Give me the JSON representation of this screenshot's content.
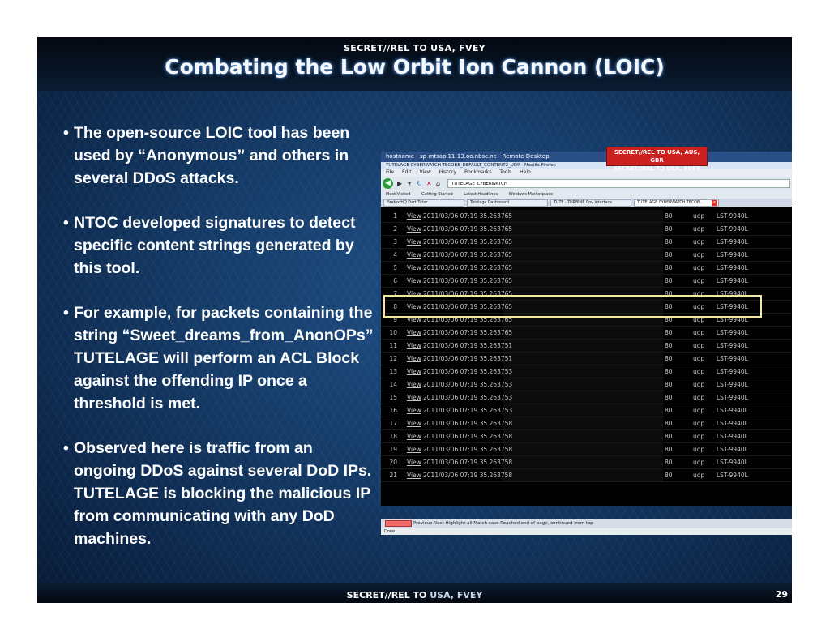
{
  "slide": {
    "classification_top": "SECRET//REL TO USA, FVEY",
    "title": "Combating the Low Orbit Ion Cannon (LOIC)",
    "classification_bottom_a": "SECRET//REL TO",
    "classification_bottom_b": "USA, FVEY",
    "page_number": "29",
    "bullets": [
      "The open-source LOIC tool has been used by “Anonymous” and others in several DDoS attacks.",
      "NTOC developed signatures to detect specific content strings generated by this tool.",
      "For example, for packets containing the string “Sweet_dreams_from_AnonOPs” TUTELAGE will perform an ACL Block against the offending IP once a threshold is met.",
      "Observed here is traffic from an ongoing DDoS against several DoD IPs. TUTELAGE is blocking the malicious IP from communicating with any DoD machines."
    ]
  },
  "screenshot": {
    "remote_desktop_title": "hostname - sp-mtsapi11-13.oo.nbsc.nc - Remote Desktop",
    "banner_line1": "SECRET//REL TO USA, AUS, GBR",
    "banner_line2": "SECRET//REL TO USA, FVEY",
    "firefox_title": "TUTELAGE CYBERWATCH-TECOBE_DEFAULT_CONTENT2_UDP - Mozilla Firefox",
    "menu": [
      "File",
      "Edit",
      "View",
      "History",
      "Bookmarks",
      "Tools",
      "Help"
    ],
    "url": "TUTELAGE_CYBERWATCH",
    "bookmarks": [
      "Most Visited",
      "Getting Started",
      "Latest Headlines",
      "Windows Marketplace"
    ],
    "tabs": [
      {
        "label": "Firefox HQ Dart Tutor",
        "active": false
      },
      {
        "label": "Tutelage Dashboard",
        "active": false
      },
      {
        "label": "TUTE - TURBINE Cov Interface",
        "active": false
      },
      {
        "label": "TUTELAGE CYBERWATCH TECOB...",
        "active": true
      }
    ],
    "rows": [
      {
        "n": "1",
        "view": "View",
        "ts": "2011/03/06 07:19 35.263765",
        "port": "80",
        "proto": "udp",
        "host": "LST-9940L"
      },
      {
        "n": "2",
        "view": "View",
        "ts": "2011/03/06 07:19 35.263765",
        "port": "80",
        "proto": "udp",
        "host": "LST-9940L"
      },
      {
        "n": "3",
        "view": "View",
        "ts": "2011/03/06 07:19 35.263765",
        "port": "80",
        "proto": "udp",
        "host": "LST-9940L"
      },
      {
        "n": "4",
        "view": "View",
        "ts": "2011/03/06 07:19 35.263765",
        "port": "80",
        "proto": "udp",
        "host": "LST-9940L"
      },
      {
        "n": "5",
        "view": "View",
        "ts": "2011/03/06 07:19 35.263765",
        "port": "80",
        "proto": "udp",
        "host": "LST-9940L"
      },
      {
        "n": "6",
        "view": "View",
        "ts": "2011/03/06 07:19 35.263765",
        "port": "80",
        "proto": "udp",
        "host": "LST-9940L"
      },
      {
        "n": "7",
        "view": "View",
        "ts": "2011/03/06 07:19 35.263765",
        "port": "80",
        "proto": "udp",
        "host": "LST-9940L"
      },
      {
        "n": "8",
        "view": "View",
        "ts": "2011/03/06 07:19 35.263765",
        "port": "80",
        "proto": "udp",
        "host": "LST-9940L"
      },
      {
        "n": "9",
        "view": "View",
        "ts": "2011/03/06 07:19 35.263765",
        "port": "80",
        "proto": "udp",
        "host": "LST-9940L"
      },
      {
        "n": "10",
        "view": "View",
        "ts": "2011/03/06 07:19 35.263765",
        "port": "80",
        "proto": "udp",
        "host": "LST-9940L"
      },
      {
        "n": "11",
        "view": "View",
        "ts": "2011/03/06 07:19 35.263751",
        "port": "80",
        "proto": "udp",
        "host": "LST-9940L"
      },
      {
        "n": "12",
        "view": "View",
        "ts": "2011/03/06 07:19 35.263751",
        "port": "80",
        "proto": "udp",
        "host": "LST-9940L"
      },
      {
        "n": "13",
        "view": "View",
        "ts": "2011/03/06 07:19 35.263753",
        "port": "80",
        "proto": "udp",
        "host": "LST-9940L"
      },
      {
        "n": "14",
        "view": "View",
        "ts": "2011/03/06 07:19 35.263753",
        "port": "80",
        "proto": "udp",
        "host": "LST-9940L"
      },
      {
        "n": "15",
        "view": "View",
        "ts": "2011/03/06 07:19 35.263753",
        "port": "80",
        "proto": "udp",
        "host": "LST-9940L"
      },
      {
        "n": "16",
        "view": "View",
        "ts": "2011/03/06 07:19 35.263753",
        "port": "80",
        "proto": "udp",
        "host": "LST-9940L"
      },
      {
        "n": "17",
        "view": "View",
        "ts": "2011/03/06 07:19 35.263758",
        "port": "80",
        "proto": "udp",
        "host": "LST-9940L"
      },
      {
        "n": "18",
        "view": "View",
        "ts": "2011/03/06 07:19 35.263758",
        "port": "80",
        "proto": "udp",
        "host": "LST-9940L"
      },
      {
        "n": "19",
        "view": "View",
        "ts": "2011/03/06 07:19 35.263758",
        "port": "80",
        "proto": "udp",
        "host": "LST-9940L"
      },
      {
        "n": "20",
        "view": "View",
        "ts": "2011/03/06 07:19 35.263758",
        "port": "80",
        "proto": "udp",
        "host": "LST-9940L"
      },
      {
        "n": "21",
        "view": "View",
        "ts": "2011/03/06 07:19 35.263758",
        "port": "80",
        "proto": "udp",
        "host": "LST-9940L"
      }
    ],
    "statusbar": "Previous   Next   Highlight all   Match case   Reached end of page, continued from top",
    "done": "Done"
  }
}
